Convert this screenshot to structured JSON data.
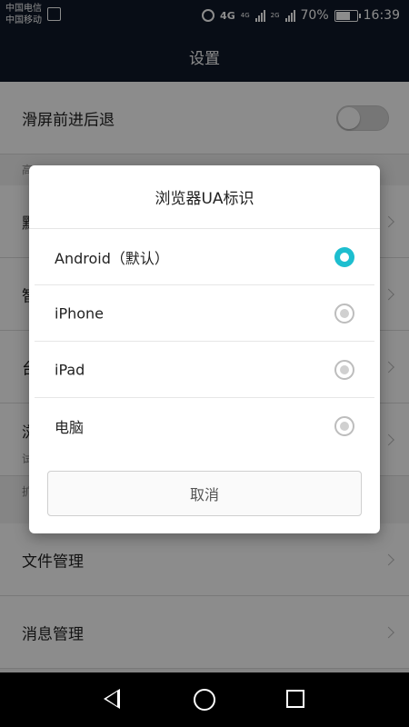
{
  "status_bar": {
    "carrier_1": "中国电信",
    "carrier_2": "中国移动",
    "network_1": "4G",
    "network_2": "4G",
    "network_3": "2G",
    "battery_percent": "70%",
    "battery_level": 0.7,
    "time": "16:39"
  },
  "title_bar": {
    "title": "设置"
  },
  "settings": {
    "swipe_nav_label": "滑屏前进后退",
    "section_advanced_partial": "高",
    "row_partial_1": "默",
    "row_partial_2": "智",
    "row_partial_3": "台",
    "row_partial_4": "浏",
    "row_partial_4_sub": "试",
    "section_ext_partial": "扩",
    "file_manage_label": "文件管理",
    "message_manage_label": "消息管理"
  },
  "dialog": {
    "title": "浏览器UA标识",
    "options": [
      {
        "label": "Android（默认）",
        "selected": true
      },
      {
        "label": "iPhone",
        "selected": false
      },
      {
        "label": "iPad",
        "selected": false
      },
      {
        "label": "电脑",
        "selected": false
      }
    ],
    "cancel_label": "取消"
  },
  "colors": {
    "accent": "#1dbecf",
    "header_bg": "#0f1929"
  }
}
